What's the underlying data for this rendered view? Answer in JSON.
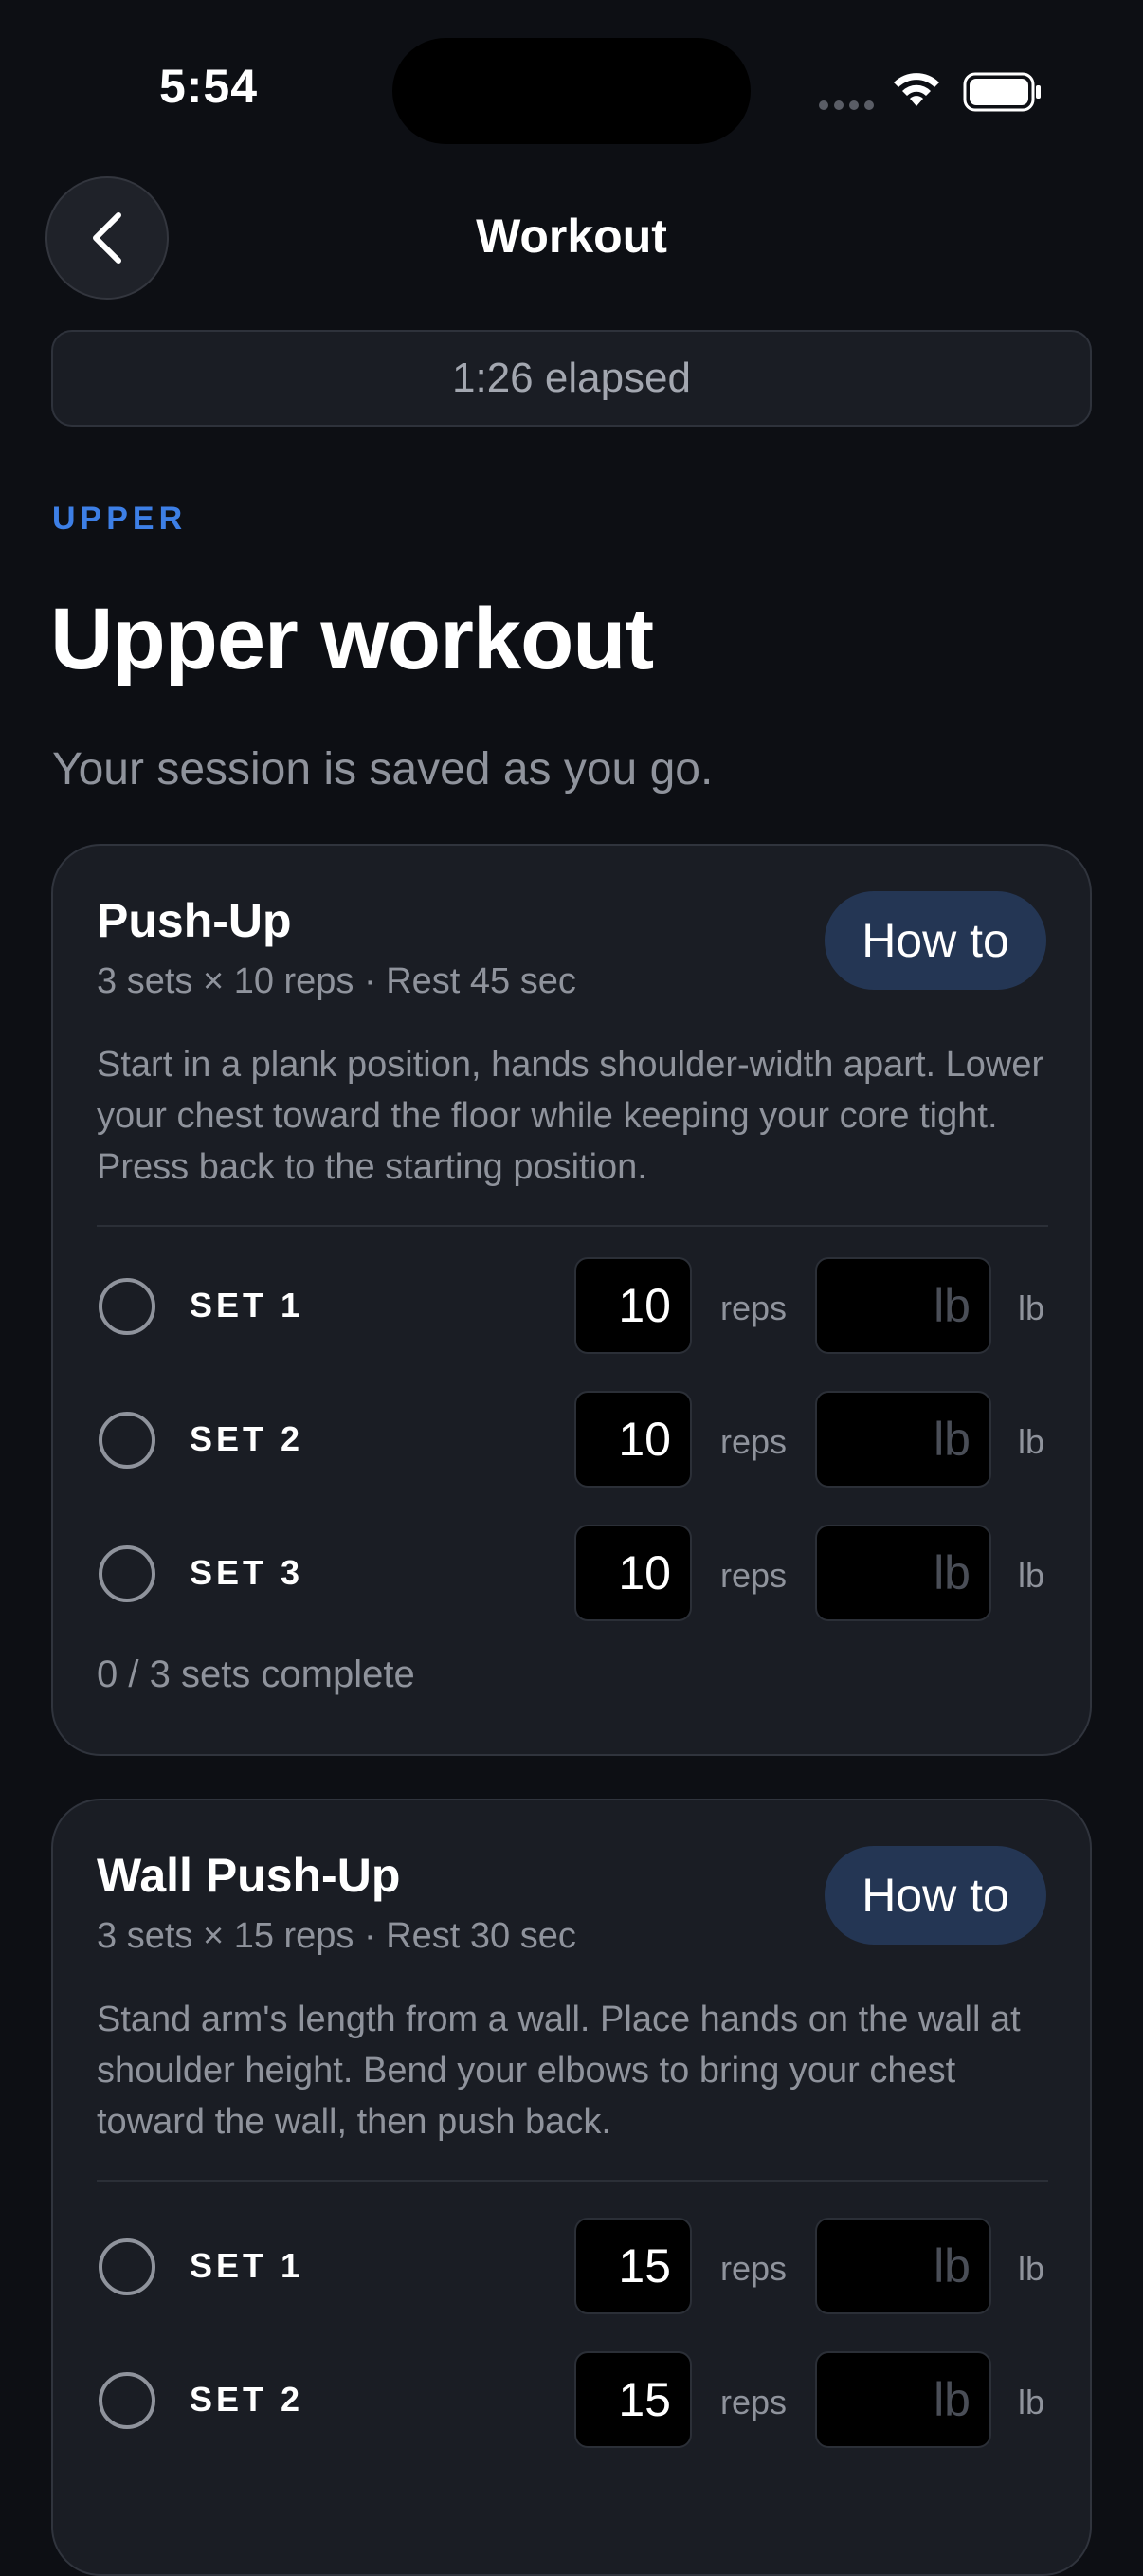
{
  "status_bar": {
    "time": "5:54"
  },
  "header": {
    "title": "Workout",
    "back_icon": "chevron-left-icon"
  },
  "timer": {
    "elapsed": "1:26 elapsed"
  },
  "workout": {
    "category": "UPPER",
    "title": "Upper workout",
    "subtitle": "Your session is saved as you go."
  },
  "colors": {
    "accent": "#3d7fe6",
    "background": "#0d0f14",
    "card": "#1a1d24",
    "howto_button": "#243654"
  },
  "exercises": [
    {
      "name": "Push-Up",
      "meta": "3 sets × 10 reps · Rest 45 sec",
      "howto_label": "How to",
      "description": "Start in a plank position, hands shoulder-width apart. Lower your chest toward the floor while keeping your core tight. Press back to the starting position.",
      "sets": [
        {
          "label": "SET 1",
          "reps": "10",
          "reps_unit": "reps",
          "weight_placeholder": "lb",
          "weight_unit": "lb"
        },
        {
          "label": "SET 2",
          "reps": "10",
          "reps_unit": "reps",
          "weight_placeholder": "lb",
          "weight_unit": "lb"
        },
        {
          "label": "SET 3",
          "reps": "10",
          "reps_unit": "reps",
          "weight_placeholder": "lb",
          "weight_unit": "lb"
        }
      ],
      "progress": "0 / 3 sets complete"
    },
    {
      "name": "Wall Push-Up",
      "meta": "3 sets × 15 reps · Rest 30 sec",
      "howto_label": "How to",
      "description": "Stand arm's length from a wall. Place hands on the wall at shoulder height. Bend your elbows to bring your chest toward the wall, then push back.",
      "sets": [
        {
          "label": "SET 1",
          "reps": "15",
          "reps_unit": "reps",
          "weight_placeholder": "lb",
          "weight_unit": "lb"
        },
        {
          "label": "SET 2",
          "reps": "15",
          "reps_unit": "reps",
          "weight_placeholder": "lb",
          "weight_unit": "lb"
        }
      ]
    }
  ]
}
